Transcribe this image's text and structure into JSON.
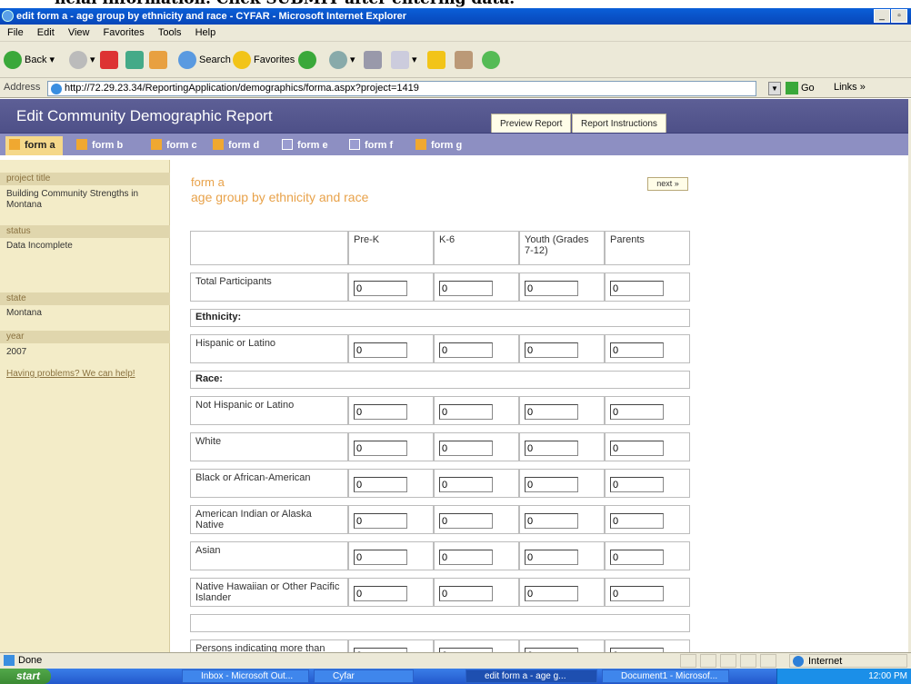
{
  "caption_text": "ncial information. Click SUBMIT after entering data.",
  "window": {
    "title": "edit form a - age group by ethnicity and race - CYFAR - Microsoft Internet Explorer",
    "minimize": "_",
    "restore": "▫"
  },
  "menu": [
    "File",
    "Edit",
    "View",
    "Favorites",
    "Tools",
    "Help"
  ],
  "toolbar": {
    "back": "Back",
    "search": "Search",
    "favorites": "Favorites"
  },
  "address": {
    "label": "Address",
    "url": "http://72.29.23.34/ReportingApplication/demographics/forma.aspx?project=1419",
    "go": "Go",
    "links": "Links »"
  },
  "app": {
    "title": "Edit Community Demographic Report",
    "top_tabs": [
      "Preview Report",
      "Report Instructions"
    ]
  },
  "form_tabs": [
    {
      "label": "form a",
      "icon": "warning-icon",
      "active": true
    },
    {
      "label": "form b",
      "icon": "warning-icon"
    },
    {
      "label": "form c",
      "icon": "warning-icon"
    },
    {
      "label": "form d",
      "icon": "warning-icon"
    },
    {
      "label": "form e",
      "icon": "check-icon"
    },
    {
      "label": "form f",
      "icon": "check-icon"
    },
    {
      "label": "form g",
      "icon": "warning-icon"
    }
  ],
  "sidebar": {
    "project_title_label": "project title",
    "project_title": "Building Community Strengths in Montana",
    "status_label": "status",
    "status": "Data Incomplete",
    "state_label": "state",
    "state": "Montana",
    "year_label": "year",
    "year": "2007",
    "help_link": "Having problems? We can help!"
  },
  "form": {
    "title": "form a",
    "subtitle": "age group by ethnicity and race",
    "next": "next »",
    "columns": [
      "Pre-K",
      "K-6",
      "Youth (Grades 7-12)",
      "Parents"
    ],
    "rows": {
      "total": "Total Participants",
      "ethnicity_header": "Ethnicity:",
      "hispanic": "Hispanic or Latino",
      "race_header": "Race:",
      "not_hispanic": "Not Hispanic or Latino",
      "white": "White",
      "black": "Black or African-American",
      "native": "American Indian or Alaska Native",
      "asian": "Asian",
      "pacific": "Native Hawaiian or Other Pacific Islander",
      "multi": "Persons indicating more than one race"
    },
    "default_value": "0"
  },
  "status": {
    "text": "Done",
    "zone": "Internet"
  },
  "taskbar": {
    "start": "start",
    "items": [
      "Inbox - Microsoft Out...",
      "Cyfar",
      "edit form a - age g...",
      "Document1 - Microsof..."
    ],
    "clock": "12:00 PM"
  },
  "colors": {
    "header_bg": "#5d5f96",
    "tab_bar": "#8d8fc2",
    "sidebar_bg": "#f3ecc8",
    "accent_orange": "#e8a24a",
    "warning_square": "#f0a830",
    "check_square": "#9a9cd0"
  }
}
